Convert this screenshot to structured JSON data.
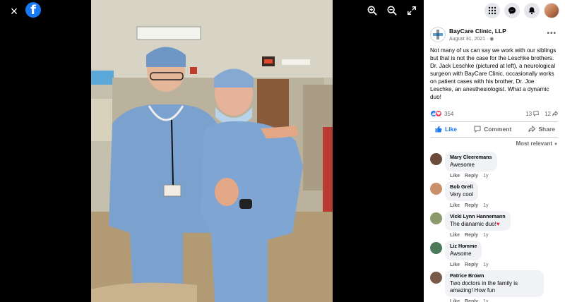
{
  "viewer": {
    "close_icon": "×",
    "logo_glyph": "f"
  },
  "panel": {
    "post": {
      "page_name": "BayCare Clinic, LLP",
      "date": "August 31, 2021",
      "text": "Not many of us can say we work with our siblings but that is not the case for the Leschke brothers. Dr. Jack Leschke (pictured at left), a neurological surgeon with BayCare Clinic, occasionally works on patient cases with his brother, Dr. Joe Leschke, an anesthesiologist. What a dynamic duo!",
      "reaction_count": "354",
      "comment_count": "13",
      "share_count": "12"
    },
    "actions": {
      "like": "Like",
      "comment": "Comment",
      "share": "Share"
    },
    "sort_label": "Most relevant",
    "comment_actions": {
      "like": "Like",
      "reply": "Reply"
    },
    "comments": [
      {
        "name": "Mary Cleeremans",
        "text": "Awesome",
        "time": "1y",
        "avatar_color": "#6b4a3a"
      },
      {
        "name": "Bob Grell",
        "text": "Very cool",
        "time": "1y",
        "avatar_color": "#c98f6b"
      },
      {
        "name": "Vicki Lynn Hannemann",
        "text": "The dianamic duo!",
        "time": "1y",
        "avatar_color": "#8a9a6a"
      },
      {
        "name": "Liz Homme",
        "text": "Awsome",
        "time": "1y",
        "avatar_color": "#4a7a5a"
      },
      {
        "name": "Patrice Brown",
        "text": "Two doctors in the family is amazing! How fun",
        "time": "1y",
        "avatar_color": "#7a5a4a"
      }
    ]
  },
  "colors": {
    "brand_blue": "#1877f2",
    "love_red": "#f33e58"
  }
}
